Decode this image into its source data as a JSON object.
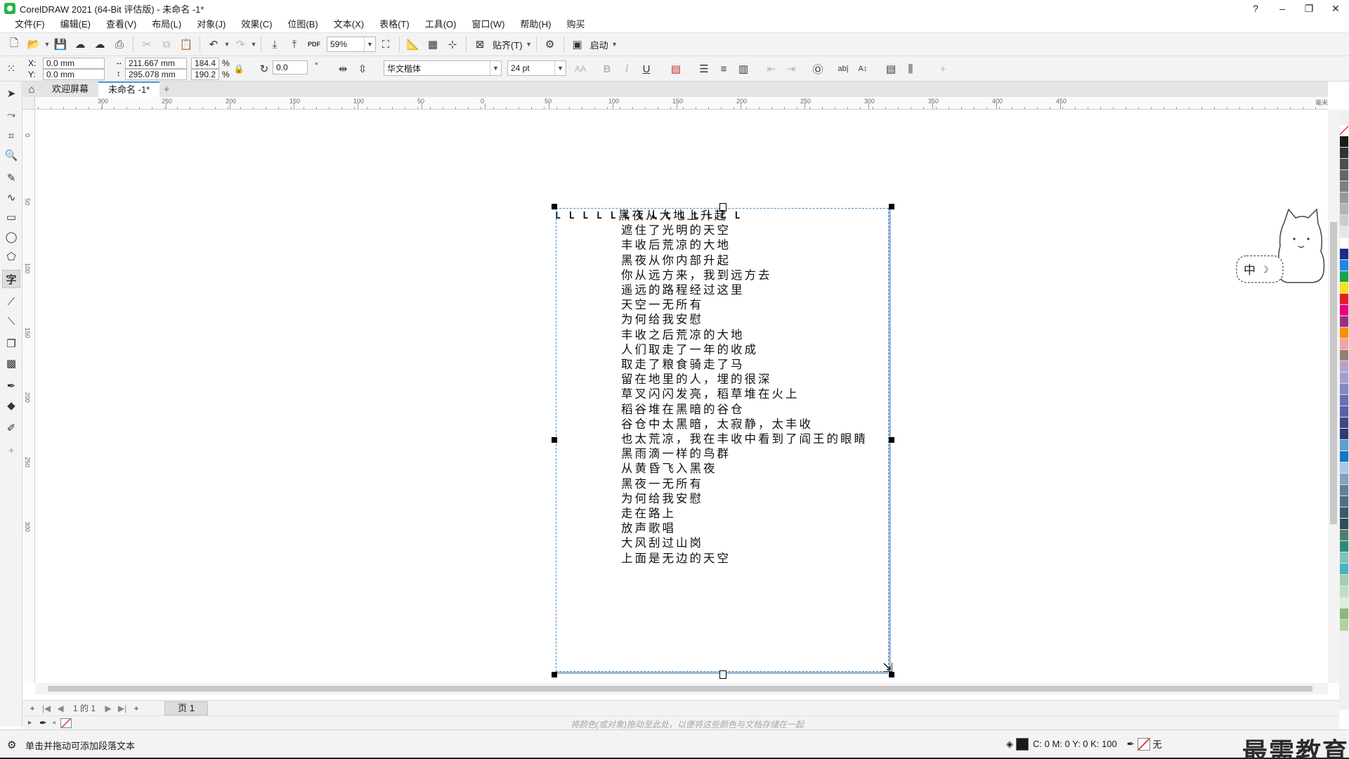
{
  "window": {
    "title": "CorelDRAW 2021 (64-Bit 评估版) - 未命名 -1*",
    "controls": {
      "help": "?",
      "minimize": "–",
      "restore": "❐",
      "close": "✕"
    }
  },
  "menu": [
    "文件(F)",
    "编辑(E)",
    "查看(V)",
    "布局(L)",
    "对象(J)",
    "效果(C)",
    "位图(B)",
    "文本(X)",
    "表格(T)",
    "工具(O)",
    "窗口(W)",
    "帮助(H)",
    "购买"
  ],
  "toolbar": {
    "zoom": "59%",
    "snap_label": "贴齐(T)",
    "launch_label": "启动",
    "pdf_label": "PDF"
  },
  "propbar": {
    "x_label": "X:",
    "x_value": "0.0 mm",
    "y_label": "Y:",
    "y_value": "0.0 mm",
    "width": "211.667 mm",
    "height": "295.078 mm",
    "scale_w": "184.4",
    "scale_h": "190.2",
    "percent": "%",
    "rotation": "0.0",
    "degree": "°",
    "font_name": "华文楷体",
    "font_size": "24 pt",
    "font_caps": "AA",
    "bold": "B",
    "italic": "I",
    "underline": "U",
    "text_direction_h": "ab|",
    "text_direction_v": "A↕"
  },
  "tabs": {
    "welcome": "欢迎屏幕",
    "document": "未命名 -1*",
    "add": "+"
  },
  "ruler": {
    "h_labels": [
      "300",
      "250",
      "200",
      "150",
      "100",
      "50",
      "0",
      "50",
      "100",
      "150",
      "200",
      "250",
      "300",
      "350",
      "400",
      "450"
    ],
    "unit": "毫米",
    "v_labels": [
      "0",
      "50",
      "100",
      "150",
      "200",
      "250",
      "300"
    ]
  },
  "tab_stops": "L L L L L L L L L L L L L L",
  "poem": [
    "黑夜从大地上升起",
    "遮住了光明的天空",
    "丰收后荒凉的大地",
    "黑夜从你内部升起",
    "你从远方来，我到远方去",
    "遥远的路程经过这里",
    "天空一无所有",
    "为何给我安慰",
    "丰收之后荒凉的大地",
    "人们取走了一年的收成",
    "取走了粮食骑走了马",
    "留在地里的人，埋的很深",
    "草叉闪闪发亮，稻草堆在火上",
    "稻谷堆在黑暗的谷仓",
    "谷仓中太黑暗，太寂静，太丰收",
    "也太荒凉，我在丰收中看到了阎王的眼睛",
    "黑雨滴一样的鸟群",
    "从黄昏飞入黑夜",
    "黑夜一无所有",
    "为何给我安慰",
    "走在路上",
    "放声歌唱",
    "大风刮过山岗",
    "上面是无边的天空"
  ],
  "ime_widget": {
    "label": "中",
    "moon": "☽"
  },
  "pagenav": {
    "add": "+",
    "first": "|◀",
    "prev": "◀",
    "page_count": "1 的 1",
    "next": "▶",
    "last": "▶|",
    "add_page": "+",
    "page_tab": "页 1"
  },
  "docpalette": {
    "hint": "将颜色(或对象)拖动至此处，以便将这些颜色与文档存储在一起"
  },
  "status": {
    "message": "单击并拖动可添加段落文本",
    "fill_cmyk": "C: 0 M: 0 Y: 0 K: 100",
    "outline_none": "无",
    "watermark": "最需教育"
  },
  "palette_colors": [
    "#1a1a1a",
    "#333333",
    "#4d4d4d",
    "#666666",
    "#808080",
    "#999999",
    "#b3b3b3",
    "#cccccc",
    "#e6e6e6",
    "#ffffff",
    "#1f2a8a",
    "#1e88e5",
    "#1aa34a",
    "#f5e21b",
    "#e31e24",
    "#e6007e",
    "#9b2d86",
    "#f39200",
    "#f5a3a3",
    "#9b8070",
    "#b7a1c9",
    "#9da2d2",
    "#8489c4",
    "#6b6fb3",
    "#5860a8",
    "#3d4a88",
    "#2f3b73",
    "#5aa0d6",
    "#0e7cc1",
    "#a9c9e4",
    "#7fa3c2",
    "#627f9a",
    "#4d6d87",
    "#385a6e",
    "#2f4f58",
    "#4d7d72",
    "#2e8b7a",
    "#7cc4b5",
    "#4ab2c2",
    "#9fcfb1",
    "#bfe0c6",
    "#ddeedf",
    "#8bb77a",
    "#b2d0a0"
  ]
}
